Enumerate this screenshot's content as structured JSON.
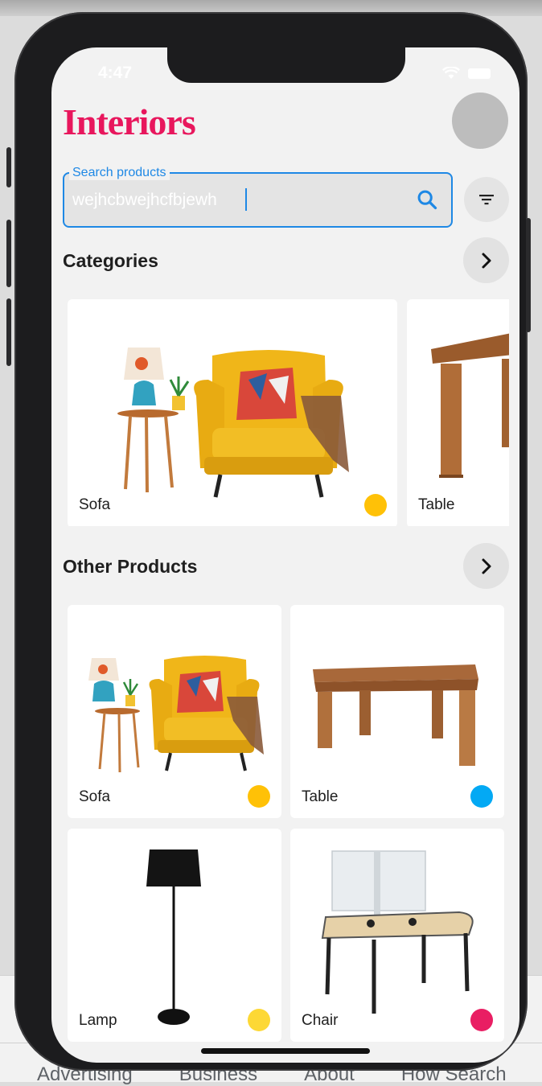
{
  "status": {
    "time": "4:47"
  },
  "app": {
    "title": "Interiors"
  },
  "search": {
    "label": "Search products",
    "value": "wejhcbwejhcfbjewh"
  },
  "categories": {
    "title": "Categories",
    "items": [
      {
        "label": "Sofa",
        "dot_color": "#ffc107"
      },
      {
        "label": "Table"
      }
    ]
  },
  "other_products": {
    "title": "Other Products",
    "items": [
      {
        "label": "Sofa",
        "dot_color": "#ffc107"
      },
      {
        "label": "Table",
        "dot_color": "#03a9f4"
      },
      {
        "label": "Lamp",
        "dot_color": "#fdd835"
      },
      {
        "label": "Chair",
        "dot_color": "#e91e63"
      }
    ]
  },
  "background_page": {
    "links": [
      "Advertising",
      "Business",
      "About",
      "How Search"
    ]
  },
  "colors": {
    "brand": "#e8175d",
    "accent": "#1e88e5"
  }
}
